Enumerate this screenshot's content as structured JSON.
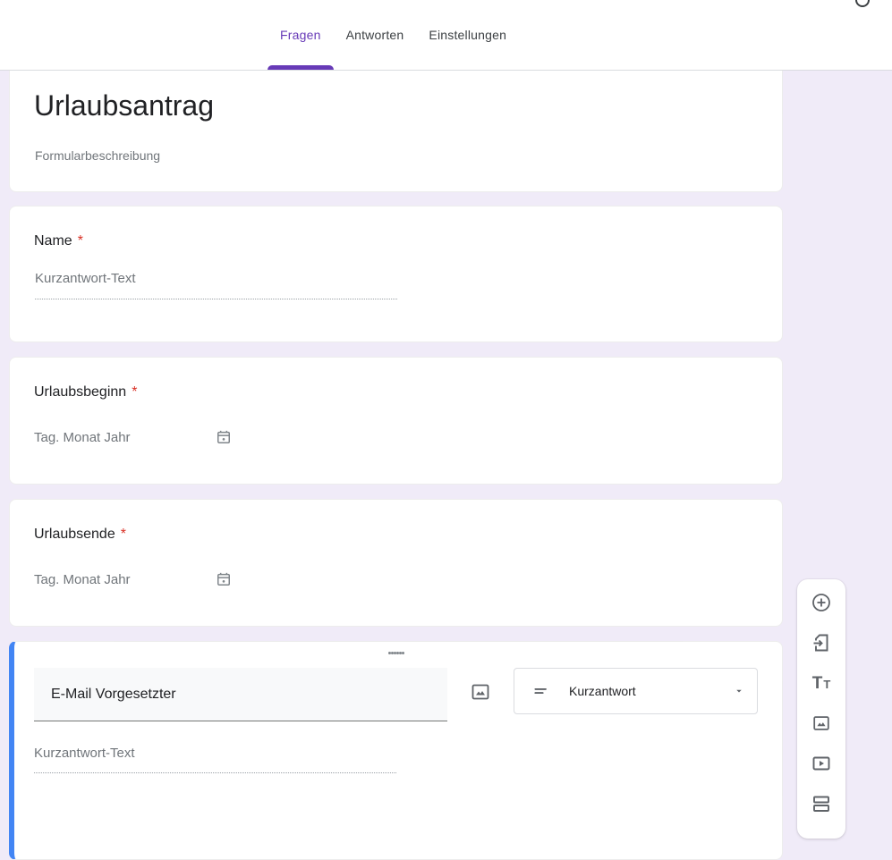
{
  "header": {
    "tabs": [
      {
        "label": "Fragen",
        "active": true
      },
      {
        "label": "Antworten",
        "active": false
      },
      {
        "label": "Einstellungen",
        "active": false
      }
    ]
  },
  "form": {
    "title": "Urlaubsantrag",
    "description": "Formularbeschreibung",
    "required_marker": "*",
    "questions": [
      {
        "label": "Name",
        "type": "short-text",
        "placeholder": "Kurzantwort-Text"
      },
      {
        "label": "Urlaubsbeginn",
        "type": "date",
        "placeholder": "Tag. Monat Jahr"
      },
      {
        "label": "Urlaubsende",
        "type": "date",
        "placeholder": "Tag. Monat Jahr"
      }
    ],
    "active_question": {
      "title_value": "E-Mail Vorgesetzter",
      "answer_placeholder": "Kurzantwort-Text",
      "type_selected": "Kurzantwort"
    }
  },
  "toolbar": {
    "tt_glyph_big": "T",
    "tt_glyph_small": "T",
    "icons": [
      "add-question",
      "import-questions",
      "add-title-and-description",
      "add-image",
      "add-video",
      "add-section"
    ]
  },
  "colors": {
    "accent_purple": "#673ab7",
    "active_card_border": "#4285f4",
    "required_red": "#d93025",
    "page_background": "#f0ebf8",
    "icon_gray": "#5f6368"
  }
}
